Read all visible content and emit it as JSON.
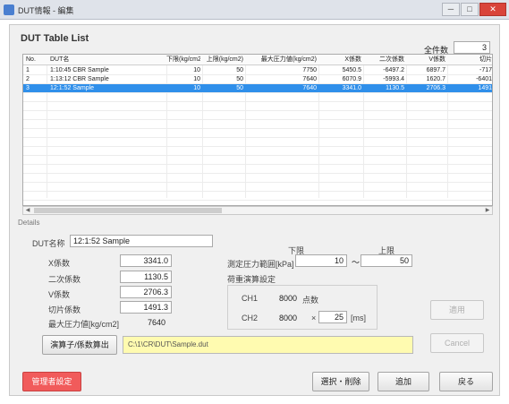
{
  "window": {
    "title": "DUT情報 - 編集",
    "min": "─",
    "max": "□",
    "close": "✕"
  },
  "list": {
    "title": "DUT Table List",
    "total_label": "全件数",
    "total_value": "3"
  },
  "table": {
    "columns": [
      "No.",
      "DUT名",
      "下限(kg/cm2)",
      "上限(kg/cm2)",
      "最大圧力値(kg/cm2)",
      "X係数",
      "二次係数",
      "V係数",
      "切片"
    ],
    "rows": [
      [
        "1",
        "1:10:45 CBR Sample",
        "10",
        "50",
        "7750",
        "5450.5",
        "-6497.2",
        "6897.7",
        "-717"
      ],
      [
        "2",
        "1:13:12 CBR Sample",
        "10",
        "50",
        "7640",
        "6070.9",
        "-5993.4",
        "1620.7",
        "-6401"
      ],
      [
        "3",
        "12:1:52 Sample",
        "10",
        "50",
        "7640",
        "3341.0",
        "1130.5",
        "2706.3",
        "1491"
      ]
    ],
    "selected_index": 2
  },
  "details": {
    "section_label": "Details",
    "dut_name_label": "DUT名称",
    "dut_name_value": "12:1:52 Sample",
    "x_coef_label": "X係数",
    "x_coef_value": "3341.0",
    "quad_coef_label": "二次係数",
    "quad_coef_value": "1130.5",
    "v_coef_label": "V係数",
    "v_coef_value": "2706.3",
    "intercept_label": "切片係数",
    "intercept_value": "1491.3",
    "max_pressure_label": "最大圧力値[kg/cm2]",
    "max_pressure_value": "7640",
    "range_label": "測定圧力範囲[kPa]",
    "lower_header": "下限",
    "upper_header": "上限",
    "lower_value": "10",
    "range_sep": "〜",
    "upper_value": "50",
    "sample_group_label": "荷重演算設定",
    "ch1_label": "CH1",
    "ch1_value": "8000",
    "ch1_unit": "点数",
    "ch2_label": "CH2",
    "ch2_value": "8000",
    "ch2_mult": "×",
    "ch2_value2": "25",
    "ch2_unit": "[ms]",
    "calc_button": "演算子/係数算出",
    "status_message": "C:\\1\\CR\\DUT\\Sample.dut"
  },
  "buttons": {
    "apply": "適用",
    "cancel": "Cancel",
    "warn": "管理者設定",
    "select_delete": "選択・削除",
    "add": "追加",
    "close": "戻る"
  },
  "colors": {
    "selection": "#2f8fea",
    "warn": "#f15b5b",
    "status_bg": "#fffbb0"
  }
}
